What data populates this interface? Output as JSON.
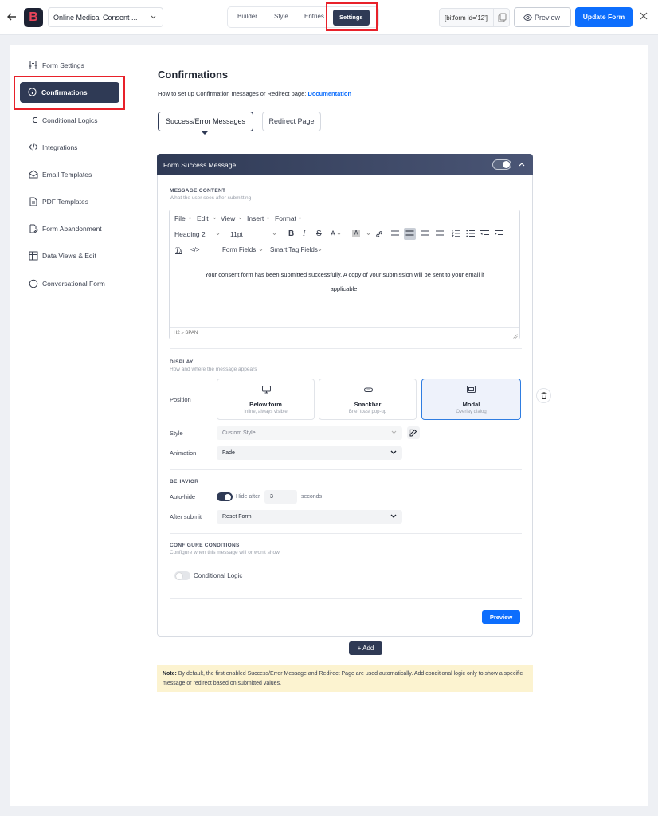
{
  "topbar": {
    "logo_letter": "B",
    "form_name": "Online Medical Consent ...",
    "tabs": [
      "Builder",
      "Style",
      "Entries",
      "Settings"
    ],
    "active_tab": "Settings",
    "shortcode": "[bitform id='12']",
    "preview_label": "Preview",
    "update_label": "Update Form"
  },
  "sidebar": {
    "items": [
      {
        "label": "Form Settings",
        "icon": "sliders-icon"
      },
      {
        "label": "Confirmations",
        "icon": "info-circle-icon",
        "active": true
      },
      {
        "label": "Conditional Logics",
        "icon": "branch-icon"
      },
      {
        "label": "Integrations",
        "icon": "code-icon"
      },
      {
        "label": "Email Templates",
        "icon": "mail-open-icon"
      },
      {
        "label": "PDF Templates",
        "icon": "file-icon"
      },
      {
        "label": "Form Abandonment",
        "icon": "edit-file-icon"
      },
      {
        "label": "Data Views & Edit",
        "icon": "table-icon"
      },
      {
        "label": "Conversational Form",
        "icon": "chat-icon"
      }
    ]
  },
  "main": {
    "title": "Confirmations",
    "subtitle": "How to set up Confirmation messages or Redirect page:",
    "doc_link": "Documentation",
    "seg_tabs": [
      "Success/Error Messages",
      "Redirect Page"
    ],
    "panel": {
      "title": "Form Success Message",
      "enabled": true,
      "message_content": {
        "label": "MESSAGE CONTENT",
        "hint": "What the user sees after submitting"
      },
      "editor": {
        "menus": [
          "File",
          "Edit",
          "View",
          "Insert",
          "Format"
        ],
        "block_format": "Heading 2",
        "font_size": "11pt",
        "form_fields": "Form Fields",
        "smart_tags": "Smart Tag Fields",
        "content": "Your consent form has been submitted successfully. A copy of your submission will be sent to your email if applicable.",
        "status_path": "H2 » SPAN",
        "clear_format_glyph": "Tx",
        "code_glyph": "</>"
      },
      "display": {
        "label": "DISPLAY",
        "hint": "How and where the message appears",
        "position_label": "Position",
        "positions": [
          {
            "name": "Below form",
            "desc": "Inline, always visible"
          },
          {
            "name": "Snackbar",
            "desc": "Brief toast pop-up"
          },
          {
            "name": "Modal",
            "desc": "Overlay dialog"
          }
        ],
        "selected_position": "Modal",
        "style_label": "Style",
        "style_value": "Custom Style",
        "animation_label": "Animation",
        "animation_value": "Fade"
      },
      "behavior": {
        "label": "BEHAVIOR",
        "autohide_label": "Auto-hide",
        "autohide_enabled": true,
        "hide_after_label": "Hide after",
        "hide_after_value": "3",
        "seconds_label": "seconds",
        "after_submit_label": "After submit",
        "after_submit_value": "Reset Form"
      },
      "conditions": {
        "label": "CONFIGURE CONDITIONS",
        "hint": "Configure when this message will or won't show",
        "toggle_label": "Conditional Logic",
        "enabled": false
      },
      "preview_label": "Preview"
    },
    "add_label": "+ Add",
    "note_bold": "Note:",
    "note_text": "By default, the first enabled Success/Error Message and Redirect Page are used automatically. Add conditional logic only to show a specific message or redirect based on submitted values."
  },
  "colors": {
    "accent": "#0d6efd",
    "navy": "#2f3a55",
    "highlight": "#e8212a"
  }
}
